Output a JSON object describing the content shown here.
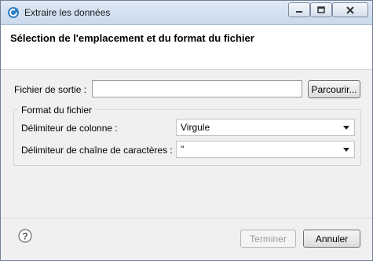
{
  "window": {
    "title": "Extraire les données"
  },
  "header": {
    "title": "Sélection de l'emplacement et du format du fichier"
  },
  "output_file": {
    "label": "Fichier de sortie :",
    "value": "",
    "browse_label": "Parcourir..."
  },
  "format_group": {
    "title": "Format du fichier",
    "column_delimiter": {
      "label": "Délimiteur de colonne :",
      "value": "Virgule"
    },
    "string_delimiter": {
      "label": "Délimiteur de chaîne de caractères :",
      "value": "\""
    }
  },
  "footer": {
    "finish_label": "Terminer",
    "cancel_label": "Annuler"
  },
  "icons": {
    "app": "app-icon",
    "minimize": "minimize-icon",
    "maximize": "maximize-icon",
    "close": "close-icon",
    "help": "help-icon",
    "dropdown": "chevron-down-icon"
  }
}
